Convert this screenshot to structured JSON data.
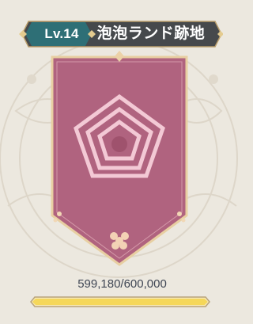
{
  "header": {
    "level": "Lv.14",
    "area_name": "泡泡ランド跡地"
  },
  "progress": {
    "label": "599,180/600,000",
    "current": 599180,
    "max": 600000
  },
  "colors": {
    "background": "#ece8df",
    "header_bg": "#46494c",
    "level_badge": "#2e6f76",
    "banner_fill": "#b0637f",
    "banner_border": "#e8cfa2",
    "emblem": "#f3c9d5",
    "bar_fill": "#f5d75a"
  },
  "icons": {
    "emblem": "pentagon-maze-blossom-icon",
    "flower": "blossom-icon"
  }
}
